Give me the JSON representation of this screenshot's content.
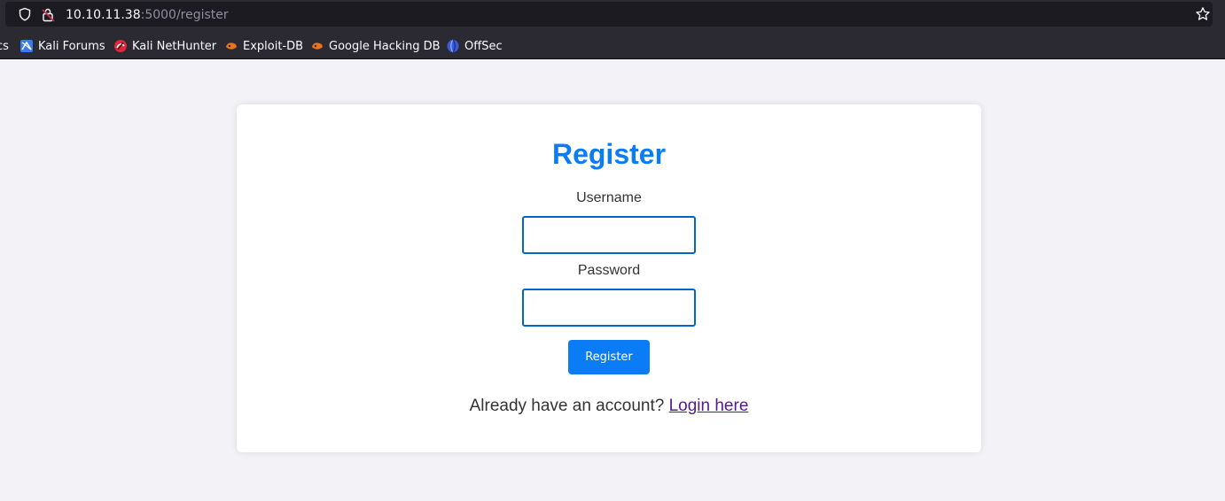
{
  "browser": {
    "url_host": "10.10.11.38",
    "url_path": ":5000/register",
    "bookmarks": [
      {
        "label": "cs",
        "icon": "truncated-bookmark"
      },
      {
        "label": "Kali Forums",
        "icon": "kali-forums-icon"
      },
      {
        "label": "Kali NetHunter",
        "icon": "kali-nethunter-icon"
      },
      {
        "label": "Exploit-DB",
        "icon": "exploit-db-icon"
      },
      {
        "label": "Google Hacking DB",
        "icon": "ghdb-icon"
      },
      {
        "label": "OffSec",
        "icon": "offsec-icon"
      }
    ]
  },
  "form": {
    "title": "Register",
    "username_label": "Username",
    "username_value": "",
    "password_label": "Password",
    "password_value": "",
    "submit_label": "Register",
    "footer_text": "Already have an account?",
    "login_link": "Login here"
  },
  "colors": {
    "accent": "#0a7cf5",
    "input_border": "#0066cc",
    "link_visited": "#551a8b",
    "page_bg": "#f3f2f7"
  }
}
